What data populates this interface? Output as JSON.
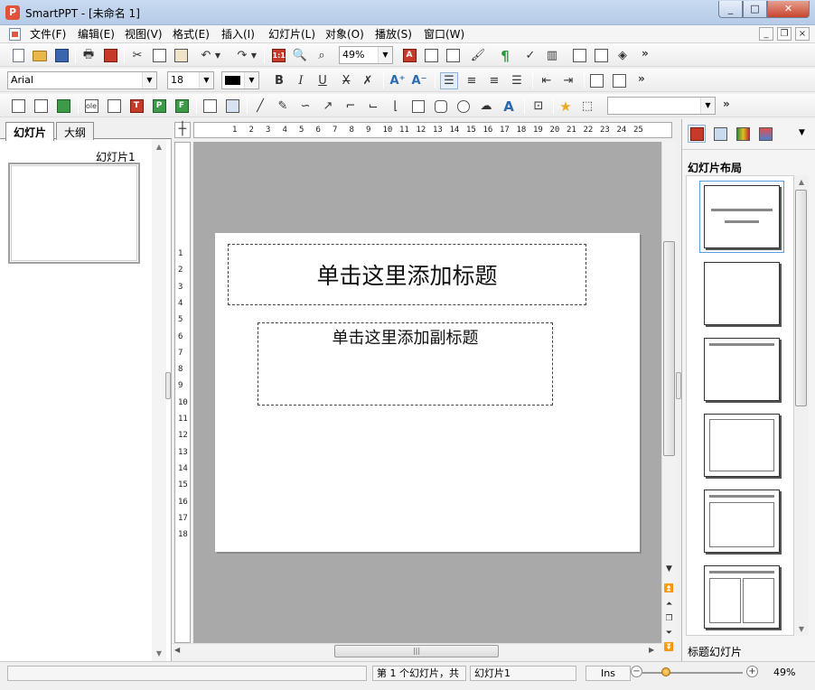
{
  "window": {
    "title": "SmartPPT - [未命名 1]",
    "app_icon_letter": "P",
    "minimize": "_",
    "maximize": "□",
    "close": "✕"
  },
  "menu": {
    "items": [
      "文件(F)",
      "编辑(E)",
      "视图(V)",
      "格式(E)",
      "插入(I)",
      "幻灯片(L)",
      "对象(O)",
      "播放(S)",
      "窗口(W)"
    ],
    "mdi_min": "_",
    "mdi_restore": "❐",
    "mdi_close": "×"
  },
  "toolbar1": {
    "zoom_value": "49%",
    "grid_label": "1:1",
    "more": "»"
  },
  "toolbar2": {
    "font_name": "Arial",
    "font_size": "18",
    "bold": "B",
    "italic": "I",
    "underline": "U",
    "more": "»"
  },
  "toolbar3": {
    "style_value": "",
    "more": "»",
    "ole_label": "ole"
  },
  "left_panel": {
    "tabs": [
      "幻灯片",
      "大纲"
    ],
    "slide_caption": "幻灯片1"
  },
  "ruler": {
    "corner": "┼",
    "h_ticks": [
      "1",
      "2",
      "3",
      "4",
      "5",
      "6",
      "7",
      "8",
      "9",
      "10",
      "11",
      "12",
      "13",
      "14",
      "15",
      "16",
      "17",
      "18",
      "19",
      "20",
      "21",
      "22",
      "23",
      "24",
      "25"
    ],
    "v_ticks": [
      "1",
      "2",
      "3",
      "4",
      "5",
      "6",
      "7",
      "8",
      "9",
      "10",
      "11",
      "12",
      "13",
      "14",
      "15",
      "16",
      "17",
      "18"
    ]
  },
  "slide": {
    "title_placeholder": "单击这里添加标题",
    "subtitle_placeholder": "单击这里添加副标题"
  },
  "right_panel": {
    "heading": "幻灯片布局",
    "selected_layout_name": "标题幻灯片",
    "dropdown": "▼"
  },
  "statusbar": {
    "slide_position": "第 1 个幻灯片，共",
    "slide_name": "幻灯片1",
    "insert_mode": "Ins",
    "zoom_percent": "49%",
    "zoom_out": "−",
    "zoom_in": "+"
  }
}
